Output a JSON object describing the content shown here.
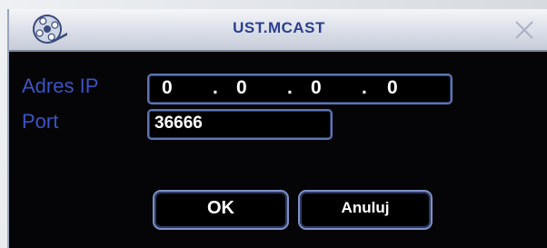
{
  "dialog": {
    "title": "UST.MCAST",
    "icons": {
      "app": "film-reel-icon",
      "close": "close-icon"
    }
  },
  "fields": {
    "ip_label": "Adres  IP",
    "ip_octets": [
      "0",
      "0",
      "0",
      "0"
    ],
    "ip_separator": ".",
    "port_label": "Port",
    "port_value": "36666"
  },
  "buttons": {
    "ok_label": "OK",
    "cancel_label": "Anuluj"
  },
  "colors": {
    "title": "#2c3f8e",
    "label": "#3d53c4",
    "field_border": "#5f76b5",
    "dialog_background": "#050507"
  }
}
